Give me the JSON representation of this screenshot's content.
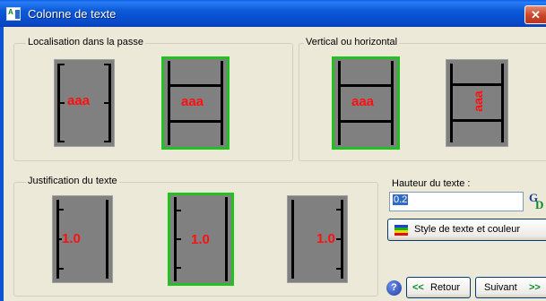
{
  "window": {
    "title": "Colonne de texte",
    "close_glyph": "✕"
  },
  "groups": {
    "location": {
      "label": "Localisation dans la passe"
    },
    "orientation": {
      "label": "Vertical ou horizontal"
    },
    "justification": {
      "label": "Justification du texte"
    }
  },
  "location_options": [
    {
      "text": "aaa",
      "selected": false
    },
    {
      "text": "aaa",
      "selected": true
    }
  ],
  "orientation_options": [
    {
      "text": "aaa",
      "orientation": "horizontal",
      "selected": true
    },
    {
      "text": "aaa",
      "orientation": "vertical",
      "selected": false
    }
  ],
  "justification_options": [
    {
      "text": "1.0",
      "align": "left",
      "selected": false
    },
    {
      "text": "1.0",
      "align": "center",
      "selected": true
    },
    {
      "text": "1.0",
      "align": "right",
      "selected": false
    }
  ],
  "text_height": {
    "label": "Hauteur du texte :",
    "value": "0.2"
  },
  "calculator_button": {
    "glyph_top": "G",
    "glyph_bottom": "D",
    "icon": "calculator-icon"
  },
  "style_button": {
    "label": "Style de texte et couleur",
    "icon": "color-swatch-icon"
  },
  "help_button": {
    "label": "?"
  },
  "back_button": {
    "arrow": "<<",
    "label": "Retour"
  },
  "next_button": {
    "label": "Suivant",
    "arrow": ">>"
  },
  "colors": {
    "selection": "#22c022",
    "sample_text": "#ff1010",
    "panel": "#808080"
  }
}
